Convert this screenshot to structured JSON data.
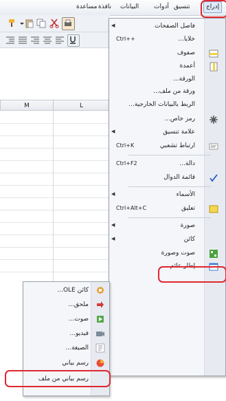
{
  "menubar": {
    "items": [
      {
        "label": "إدراج",
        "active": true
      },
      {
        "label": "تنسيق"
      },
      {
        "label": "أدوات"
      },
      {
        "label": "البيانات"
      },
      {
        "label": "نافذة"
      },
      {
        "label": "مساعدة"
      }
    ]
  },
  "sheet": {
    "columns": [
      "M",
      "L"
    ]
  },
  "insert_menu": {
    "items": [
      {
        "label": "فاصل الصفحات",
        "submenu": true,
        "icon": ""
      },
      {
        "label": "خلايا...",
        "shortcut": "Ctrl++",
        "icon": ""
      },
      {
        "label": "صفوف",
        "icon": "insert-rows-icon"
      },
      {
        "label": "أعمدة",
        "icon": "insert-columns-icon"
      },
      {
        "label": "الورقة...",
        "icon": ""
      },
      {
        "label": "ورقة من ملف...",
        "icon": ""
      },
      {
        "label": "الربط بالبيانات الخارجية...",
        "icon": ""
      },
      {
        "label": "رمز خاص...",
        "icon": "special-character-icon"
      },
      {
        "label": "علامة تنسيق",
        "submenu": true,
        "icon": ""
      },
      {
        "label": "ارتباط تشعبي",
        "shortcut": "Ctrl+K",
        "icon": "hyperlink-icon"
      },
      {
        "label": "دالة...",
        "shortcut": "Ctrl+F2",
        "icon": ""
      },
      {
        "label": "قائمة الدوال",
        "icon": "checkmark-icon"
      },
      {
        "label": "الأسماء",
        "submenu": true,
        "icon": ""
      },
      {
        "label": "تعليق",
        "shortcut": "Ctrl+Alt+C",
        "icon": "comment-icon"
      },
      {
        "label": "صورة",
        "submenu": true,
        "icon": ""
      },
      {
        "label": "كائن",
        "submenu": true,
        "icon": "",
        "highlighted": true
      },
      {
        "label": "صوت وصورة",
        "icon": "movie-icon"
      },
      {
        "label": "إطار عائم...",
        "icon": "floating-frame-icon"
      }
    ]
  },
  "object_submenu": {
    "items": [
      {
        "label": "كائن OLE...",
        "icon": "ole-object-icon"
      },
      {
        "label": "ملحق...",
        "icon": "plugin-icon"
      },
      {
        "label": "صوت...",
        "icon": "sound-icon"
      },
      {
        "label": "فيديو...",
        "icon": "video-icon"
      },
      {
        "label": "الصيغة...",
        "icon": "formula-icon"
      },
      {
        "label": "رسم بياني",
        "icon": "chart-icon",
        "highlighted": true
      },
      {
        "label": "رسم بياني من ملف",
        "icon": ""
      }
    ]
  }
}
